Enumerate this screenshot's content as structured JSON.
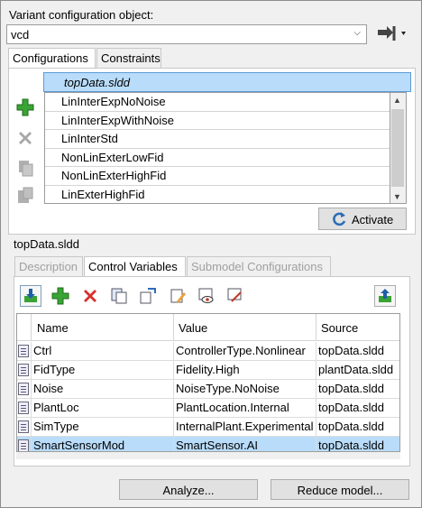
{
  "variant_object": {
    "label": "Variant configuration object:",
    "value": "vcd"
  },
  "top_tabs": [
    "Configurations",
    "Constraints"
  ],
  "configurations": {
    "header": "topData.sldd",
    "items": [
      "LinInterExpNoNoise",
      "LinInterExpWithNoise",
      "LinInterStd",
      "NonLinExterLowFid",
      "NonLinExterHighFid",
      "LinExterHighFid"
    ]
  },
  "activate_label": "Activate",
  "section_label": "topData.sldd",
  "bottom_tabs": [
    "Description",
    "Control Variables",
    "Submodel Configurations"
  ],
  "grid": {
    "columns": [
      "Name",
      "Value",
      "Source"
    ],
    "rows": [
      {
        "name": "Ctrl",
        "value": "ControllerType.Nonlinear",
        "source": "topData.sldd"
      },
      {
        "name": "FidType",
        "value": "Fidelity.High",
        "source": "plantData.sldd"
      },
      {
        "name": "Noise",
        "value": "NoiseType.NoNoise",
        "source": "topData.sldd"
      },
      {
        "name": "PlantLoc",
        "value": "PlantLocation.Internal",
        "source": "topData.sldd"
      },
      {
        "name": "SimType",
        "value": "InternalPlant.Experimental",
        "source": "topData.sldd"
      },
      {
        "name": "SmartSensorMod",
        "value": "SmartSensor.AI",
        "source": "topData.sldd"
      }
    ],
    "selected_index": 5
  },
  "footer": {
    "analyze_label": "Analyze...",
    "reduce_label": "Reduce model..."
  },
  "colors": {
    "selection": "#b9dcfa",
    "add_green": "#3aa335",
    "delete_red": "#d9302c"
  }
}
